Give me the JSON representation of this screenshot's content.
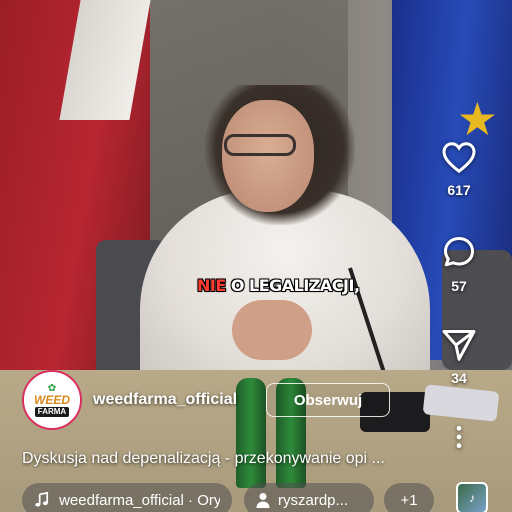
{
  "video": {
    "caption_highlight": "NIE",
    "caption_rest": " O LEGALIZACJI,"
  },
  "actions": {
    "likes": "617",
    "comments": "57",
    "shares": "34"
  },
  "account": {
    "logo_top": "WEED",
    "logo_bottom": "FARMA",
    "username": "weedfarma_official",
    "follow_label": "Obserwuj"
  },
  "description": "Dyskusja nad depenalizacją - przekonywanie opi ...",
  "audio": {
    "label": "weedfarma_official · Oryg"
  },
  "collab": {
    "label": "ryszardp..."
  },
  "more_collaborators": "+1",
  "icons": {
    "like": "heart-icon",
    "comment": "comment-bubble-icon",
    "share": "send-icon",
    "more": "more-vertical-icon",
    "audio": "music-note-icon",
    "collab": "person-icon"
  }
}
